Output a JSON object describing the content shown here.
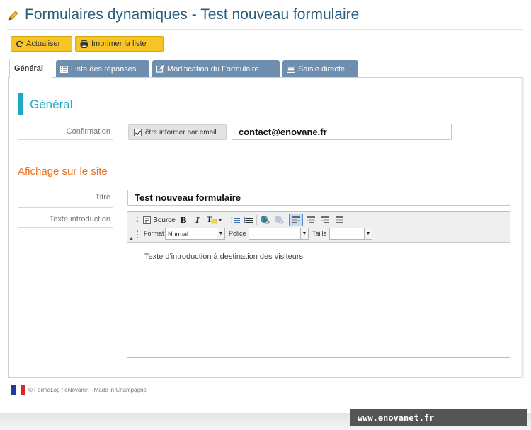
{
  "page": {
    "title": "Formulaires dynamiques - Test nouveau formulaire"
  },
  "toolbar": {
    "refresh_label": "Actualiser",
    "print_label": "Imprimer la liste"
  },
  "tabs": [
    {
      "label": "Général",
      "active": true
    },
    {
      "label": "Liste des réponses",
      "active": false
    },
    {
      "label": "Modification du Formulaire",
      "active": false
    },
    {
      "label": "Saisie directe",
      "active": false
    }
  ],
  "general": {
    "title": "Général",
    "confirmation_label": "Confirmation",
    "email_toggle_label": "être informer par email",
    "email_checked": true,
    "email_value": "contact@enovane.fr"
  },
  "display": {
    "title": "Afichage sur le site",
    "title_label": "Titre",
    "title_value": "Test nouveau formulaire",
    "intro_label": "Texte introduction"
  },
  "editor": {
    "source_label": "Source",
    "bold_label": "B",
    "italic_label": "I",
    "format_label": "Format",
    "format_value": "Normal",
    "font_label": "Police",
    "font_value": "",
    "size_label": "Taille",
    "size_value": "",
    "content": "Texte d'introduction à destination des visiteurs."
  },
  "footer": {
    "text": "© FormaLog / eNovanet - Made in Champagne"
  },
  "watermark": {
    "text": "www.enovanet.fr"
  },
  "colors": {
    "accent_blue": "#1ea8c9",
    "accent_orange": "#ea6f20",
    "button_yellow": "#f6c525",
    "tab_blue": "#6d8eaf",
    "title_blue": "#2b5d7c"
  }
}
